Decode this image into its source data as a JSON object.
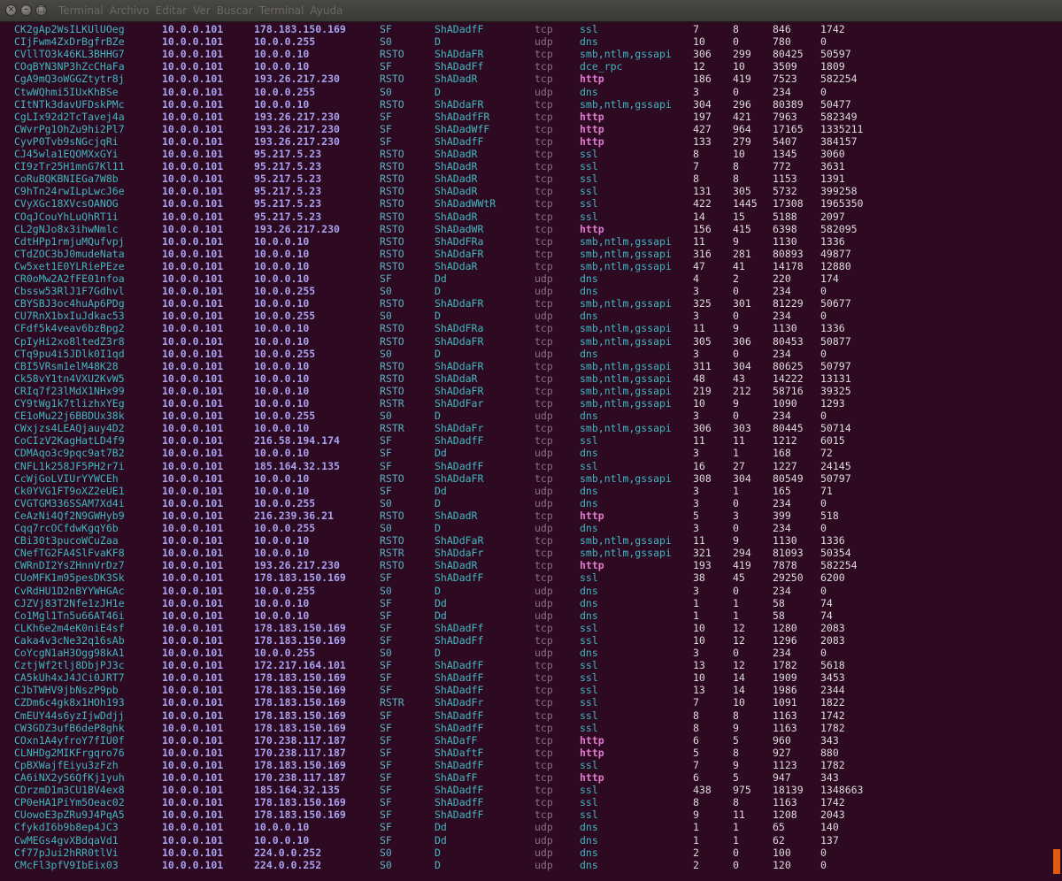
{
  "window": {
    "menu": [
      "Terminal",
      "Archivo",
      "Editar",
      "Ver",
      "Buscar",
      "Terminal",
      "Ayuda"
    ],
    "close_glyph": "×",
    "minimize_glyph": "–",
    "maximize_glyph": "□"
  },
  "colors": {
    "background": "#2d0922",
    "accent_http": "#e07bd0",
    "uid": "#3fb8c0",
    "ip": "#a8a2ef",
    "numeric": "#dddcdc",
    "resize_grip": "#e35a0f"
  },
  "rows": [
    [
      "CK2gAp2WsILKUlUOeg",
      "10.0.0.101",
      "178.183.150.169",
      "SF",
      "ShADadfF",
      "tcp",
      "ssl",
      "7",
      "8",
      "846",
      "1742"
    ],
    [
      "CIjFwm4ZxDrBgfrBZe",
      "10.0.0.101",
      "10.0.0.255",
      "S0",
      "D",
      "udp",
      "dns",
      "10",
      "0",
      "780",
      "0"
    ],
    [
      "CVllTO3k46KL3BHHG7",
      "10.0.0.101",
      "10.0.0.10",
      "RSTO",
      "ShADdaFR",
      "tcp",
      "smb,ntlm,gssapi",
      "306",
      "299",
      "80425",
      "50597"
    ],
    [
      "COqBYN3NP3hZcCHaFa",
      "10.0.0.101",
      "10.0.0.10",
      "SF",
      "ShADadFf",
      "tcp",
      "dce_rpc",
      "12",
      "10",
      "3509",
      "1809"
    ],
    [
      "CgA9mQ3oWGGZtytr8j",
      "10.0.0.101",
      "193.26.217.230",
      "RSTO",
      "ShADadR",
      "tcp",
      "http",
      "186",
      "419",
      "7523",
      "582254"
    ],
    [
      "CtwWQhmi5IUxKhBSe",
      "10.0.0.101",
      "10.0.0.255",
      "S0",
      "D",
      "udp",
      "dns",
      "3",
      "0",
      "234",
      "0"
    ],
    [
      "CItNTk3davUFDskPMc",
      "10.0.0.101",
      "10.0.0.10",
      "RSTO",
      "ShADdaFR",
      "tcp",
      "smb,ntlm,gssapi",
      "304",
      "296",
      "80389",
      "50477"
    ],
    [
      "CgLIx92d2TcTavej4a",
      "10.0.0.101",
      "193.26.217.230",
      "SF",
      "ShADadfFR",
      "tcp",
      "http",
      "197",
      "421",
      "7963",
      "582349"
    ],
    [
      "CWvrPg1OhZu9hi2Pl7",
      "10.0.0.101",
      "193.26.217.230",
      "SF",
      "ShADadWfF",
      "tcp",
      "http",
      "427",
      "964",
      "17165",
      "1335211"
    ],
    [
      "CyvP0Tvb9sNGcjqRi",
      "10.0.0.101",
      "193.26.217.230",
      "SF",
      "ShADadfF",
      "tcp",
      "http",
      "133",
      "279",
      "5407",
      "384157"
    ],
    [
      "CJ45wla1EQOMXxGYi",
      "10.0.0.101",
      "95.217.5.23",
      "RSTO",
      "ShADadR",
      "tcp",
      "ssl",
      "8",
      "10",
      "1345",
      "3060"
    ],
    [
      "CI9zTr25H1mnG7Kl11",
      "10.0.0.101",
      "95.217.5.23",
      "RSTO",
      "ShADadR",
      "tcp",
      "ssl",
      "7",
      "8",
      "772",
      "3631"
    ],
    [
      "CoRuBQKBNIEGa7W8b",
      "10.0.0.101",
      "95.217.5.23",
      "RSTO",
      "ShADadR",
      "tcp",
      "ssl",
      "8",
      "8",
      "1153",
      "1391"
    ],
    [
      "C9hTn24rwILpLwcJ6e",
      "10.0.0.101",
      "95.217.5.23",
      "RSTO",
      "ShADadR",
      "tcp",
      "ssl",
      "131",
      "305",
      "5732",
      "399258"
    ],
    [
      "CVyXGc18XVcsOANOG",
      "10.0.0.101",
      "95.217.5.23",
      "RSTO",
      "ShADadWWtR",
      "tcp",
      "ssl",
      "422",
      "1445",
      "17308",
      "1965350"
    ],
    [
      "COqJCouYhLuQhRT1i",
      "10.0.0.101",
      "95.217.5.23",
      "RSTO",
      "ShADadR",
      "tcp",
      "ssl",
      "14",
      "15",
      "5188",
      "2097"
    ],
    [
      "CL2gNJo8x3ihwNmlc",
      "10.0.0.101",
      "193.26.217.230",
      "RSTO",
      "ShADadWR",
      "tcp",
      "http",
      "156",
      "415",
      "6398",
      "582095"
    ],
    [
      "CdtHPp1rmjuMQufvpj",
      "10.0.0.101",
      "10.0.0.10",
      "RSTO",
      "ShADdFRa",
      "tcp",
      "smb,ntlm,gssapi",
      "11",
      "9",
      "1130",
      "1336"
    ],
    [
      "CTdZOC3bJ0mudeNata",
      "10.0.0.101",
      "10.0.0.10",
      "RSTO",
      "ShADdaFR",
      "tcp",
      "smb,ntlm,gssapi",
      "316",
      "281",
      "80893",
      "49877"
    ],
    [
      "Cw5xet1E0YLRiePEze",
      "10.0.0.101",
      "10.0.0.10",
      "RSTO",
      "ShADdaR",
      "tcp",
      "smb,ntlm,gssapi",
      "47",
      "41",
      "14178",
      "12880"
    ],
    [
      "CR0oMw2A2fFE01nfoa",
      "10.0.0.101",
      "10.0.0.10",
      "SF",
      "Dd",
      "udp",
      "dns",
      "4",
      "2",
      "220",
      "174"
    ],
    [
      "Cbssw53RlJ1F7Gdhvl",
      "10.0.0.101",
      "10.0.0.255",
      "S0",
      "D",
      "udp",
      "dns",
      "3",
      "0",
      "234",
      "0"
    ],
    [
      "CBYSBJ3oc4huAp6PDg",
      "10.0.0.101",
      "10.0.0.10",
      "RSTO",
      "ShADdaFR",
      "tcp",
      "smb,ntlm,gssapi",
      "325",
      "301",
      "81229",
      "50677"
    ],
    [
      "CU7RnX1bxIuJdkac53",
      "10.0.0.101",
      "10.0.0.255",
      "S0",
      "D",
      "udp",
      "dns",
      "3",
      "0",
      "234",
      "0"
    ],
    [
      "CFdf5k4veav6bzBpg2",
      "10.0.0.101",
      "10.0.0.10",
      "RSTO",
      "ShADdFRa",
      "tcp",
      "smb,ntlm,gssapi",
      "11",
      "9",
      "1130",
      "1336"
    ],
    [
      "CpIyHi2xo8ltedZ3r8",
      "10.0.0.101",
      "10.0.0.10",
      "RSTO",
      "ShADdaFR",
      "tcp",
      "smb,ntlm,gssapi",
      "305",
      "306",
      "80453",
      "50877"
    ],
    [
      "CTq9pu4i5JDlk0I1qd",
      "10.0.0.101",
      "10.0.0.255",
      "S0",
      "D",
      "udp",
      "dns",
      "3",
      "0",
      "234",
      "0"
    ],
    [
      "CBI5VRsm1elM48K28",
      "10.0.0.101",
      "10.0.0.10",
      "RSTO",
      "ShADdaFR",
      "tcp",
      "smb,ntlm,gssapi",
      "311",
      "304",
      "80625",
      "50797"
    ],
    [
      "Ck58vY1tn4VXU2KvW5",
      "10.0.0.101",
      "10.0.0.10",
      "RSTO",
      "ShADdaR",
      "tcp",
      "smb,ntlm,gssapi",
      "48",
      "43",
      "14222",
      "13131"
    ],
    [
      "CRIq7f23lMdX1NHx99",
      "10.0.0.101",
      "10.0.0.10",
      "RSTO",
      "ShADdaFR",
      "tcp",
      "smb,ntlm,gssapi",
      "219",
      "212",
      "58716",
      "39325"
    ],
    [
      "CY9tWg1k7tlizhxYEg",
      "10.0.0.101",
      "10.0.0.10",
      "RSTR",
      "ShADdFar",
      "tcp",
      "smb,ntlm,gssapi",
      "10",
      "9",
      "1090",
      "1293"
    ],
    [
      "CE1oMu22j6BBDUx38k",
      "10.0.0.101",
      "10.0.0.255",
      "S0",
      "D",
      "udp",
      "dns",
      "3",
      "0",
      "234",
      "0"
    ],
    [
      "CWxjzs4LEAQjauy4D2",
      "10.0.0.101",
      "10.0.0.10",
      "RSTR",
      "ShADdaFr",
      "tcp",
      "smb,ntlm,gssapi",
      "306",
      "303",
      "80445",
      "50714"
    ],
    [
      "CoCIzV2KagHatLD4f9",
      "10.0.0.101",
      "216.58.194.174",
      "SF",
      "ShADadfF",
      "tcp",
      "ssl",
      "11",
      "11",
      "1212",
      "6015"
    ],
    [
      "CDMAqo3c9pqc9at7B2",
      "10.0.0.101",
      "10.0.0.10",
      "SF",
      "Dd",
      "udp",
      "dns",
      "3",
      "1",
      "168",
      "72"
    ],
    [
      "CNFL1k258JF5PH2r7i",
      "10.0.0.101",
      "185.164.32.135",
      "SF",
      "ShADadfF",
      "tcp",
      "ssl",
      "16",
      "27",
      "1227",
      "24145"
    ],
    [
      "CcWjGoLVIUrYYWCEh",
      "10.0.0.101",
      "10.0.0.10",
      "RSTO",
      "ShADdaFR",
      "tcp",
      "smb,ntlm,gssapi",
      "308",
      "304",
      "80549",
      "50797"
    ],
    [
      "Ck0YVG1FT9oXZ2eUE1",
      "10.0.0.101",
      "10.0.0.10",
      "SF",
      "Dd",
      "udp",
      "dns",
      "3",
      "1",
      "165",
      "71"
    ],
    [
      "CVGTGM336SSAM7Xd4i",
      "10.0.0.101",
      "10.0.0.255",
      "S0",
      "D",
      "udp",
      "dns",
      "3",
      "0",
      "234",
      "0"
    ],
    [
      "CeAzNi4Qf2N9GWHyb9",
      "10.0.0.101",
      "216.239.36.21",
      "RSTO",
      "ShADadR",
      "tcp",
      "http",
      "5",
      "3",
      "399",
      "518"
    ],
    [
      "Cqq7rcOCfdwKgqY6b",
      "10.0.0.101",
      "10.0.0.255",
      "S0",
      "D",
      "udp",
      "dns",
      "3",
      "0",
      "234",
      "0"
    ],
    [
      "CBi30t3pucoWCuZaa",
      "10.0.0.101",
      "10.0.0.10",
      "RSTO",
      "ShADdFaR",
      "tcp",
      "smb,ntlm,gssapi",
      "11",
      "9",
      "1130",
      "1336"
    ],
    [
      "CNefTG2FA4SlFvaKF8",
      "10.0.0.101",
      "10.0.0.10",
      "RSTR",
      "ShADdaFr",
      "tcp",
      "smb,ntlm,gssapi",
      "321",
      "294",
      "81093",
      "50354"
    ],
    [
      "CWRnDI2YsZHnnVrDz7",
      "10.0.0.101",
      "193.26.217.230",
      "RSTO",
      "ShADadR",
      "tcp",
      "http",
      "193",
      "419",
      "7878",
      "582254"
    ],
    [
      "CUoMFK1m95pesDK3Sk",
      "10.0.0.101",
      "178.183.150.169",
      "SF",
      "ShADadfF",
      "tcp",
      "ssl",
      "38",
      "45",
      "29250",
      "6200"
    ],
    [
      "CvRdHU1D2nBYYWHGAc",
      "10.0.0.101",
      "10.0.0.255",
      "S0",
      "D",
      "udp",
      "dns",
      "3",
      "0",
      "234",
      "0"
    ],
    [
      "CJZVj83T2Nfe1zJH1e",
      "10.0.0.101",
      "10.0.0.10",
      "SF",
      "Dd",
      "udp",
      "dns",
      "1",
      "1",
      "58",
      "74"
    ],
    [
      "Co1Mgl1Tn5u66AT46i",
      "10.0.0.101",
      "10.0.0.10",
      "SF",
      "Dd",
      "udp",
      "dns",
      "1",
      "1",
      "58",
      "74"
    ],
    [
      "CLKh6e2m4eK0niE4sf",
      "10.0.0.101",
      "178.183.150.169",
      "SF",
      "ShADadFf",
      "tcp",
      "ssl",
      "10",
      "12",
      "1280",
      "2083"
    ],
    [
      "Caka4v3cNe32q16sAb",
      "10.0.0.101",
      "178.183.150.169",
      "SF",
      "ShADadFf",
      "tcp",
      "ssl",
      "10",
      "12",
      "1296",
      "2083"
    ],
    [
      "CoYcgN1aH3Ogg98kA1",
      "10.0.0.101",
      "10.0.0.255",
      "S0",
      "D",
      "udp",
      "dns",
      "3",
      "0",
      "234",
      "0"
    ],
    [
      "CztjWf2tlj8DbjPJ3c",
      "10.0.0.101",
      "172.217.164.101",
      "SF",
      "ShADadfF",
      "tcp",
      "ssl",
      "13",
      "12",
      "1782",
      "5618"
    ],
    [
      "CA5kUh4xJ4JCi0JRT7",
      "10.0.0.101",
      "178.183.150.169",
      "SF",
      "ShADadfF",
      "tcp",
      "ssl",
      "10",
      "14",
      "1909",
      "3453"
    ],
    [
      "CJbTWHV9jbNszP9pb",
      "10.0.0.101",
      "178.183.150.169",
      "SF",
      "ShADadfF",
      "tcp",
      "ssl",
      "13",
      "14",
      "1986",
      "2344"
    ],
    [
      "CZDm6c4gk8x1HOh193",
      "10.0.0.101",
      "178.183.150.169",
      "RSTR",
      "ShADadFr",
      "tcp",
      "ssl",
      "7",
      "10",
      "1091",
      "1822"
    ],
    [
      "CmEUY44s6yzIjwDdjj",
      "10.0.0.101",
      "178.183.150.169",
      "SF",
      "ShADadfF",
      "tcp",
      "ssl",
      "8",
      "8",
      "1163",
      "1742"
    ],
    [
      "CW3GDZ3ufB6deP8ghk",
      "10.0.0.101",
      "178.183.150.169",
      "SF",
      "ShADadfF",
      "tcp",
      "ssl",
      "8",
      "9",
      "1163",
      "1782"
    ],
    [
      "COxn1A4yfroY7fIU0f",
      "10.0.0.101",
      "170.238.117.187",
      "SF",
      "ShADafF",
      "tcp",
      "http",
      "6",
      "5",
      "960",
      "343"
    ],
    [
      "CLNHDg2MIKFrgqro76",
      "10.0.0.101",
      "170.238.117.187",
      "SF",
      "ShADaftF",
      "tcp",
      "http",
      "5",
      "8",
      "927",
      "880"
    ],
    [
      "CpBXWajfEiyu3zFzh",
      "10.0.0.101",
      "178.183.150.169",
      "SF",
      "ShADadfF",
      "tcp",
      "ssl",
      "7",
      "9",
      "1123",
      "1782"
    ],
    [
      "CA6iNX2yS6QfKj1yuh",
      "10.0.0.101",
      "170.238.117.187",
      "SF",
      "ShADafF",
      "tcp",
      "http",
      "6",
      "5",
      "947",
      "343"
    ],
    [
      "CDrzmD1m3CU1BV4ex8",
      "10.0.0.101",
      "185.164.32.135",
      "SF",
      "ShADadfF",
      "tcp",
      "ssl",
      "438",
      "975",
      "18139",
      "1348663"
    ],
    [
      "CP0eHA1PiYm5Oeac02",
      "10.0.0.101",
      "178.183.150.169",
      "SF",
      "ShADadfF",
      "tcp",
      "ssl",
      "8",
      "8",
      "1163",
      "1742"
    ],
    [
      "CUowoE3pZRu9J4PqA5",
      "10.0.0.101",
      "178.183.150.169",
      "SF",
      "ShADadfF",
      "tcp",
      "ssl",
      "9",
      "11",
      "1208",
      "2043"
    ],
    [
      "CfykdI6b9b8ep4JC3",
      "10.0.0.101",
      "10.0.0.10",
      "SF",
      "Dd",
      "udp",
      "dns",
      "1",
      "1",
      "65",
      "140"
    ],
    [
      "CwMEGs4gvXBdqaVd1",
      "10.0.0.101",
      "10.0.0.10",
      "SF",
      "Dd",
      "udp",
      "dns",
      "1",
      "1",
      "62",
      "137"
    ],
    [
      "Cf77pJui2hRR0tlVi",
      "10.0.0.101",
      "224.0.0.252",
      "S0",
      "D",
      "udp",
      "dns",
      "2",
      "0",
      "100",
      "0"
    ],
    [
      "CMcFl3pfV9IbEix03",
      "10.0.0.101",
      "224.0.0.252",
      "S0",
      "D",
      "udp",
      "dns",
      "2",
      "0",
      "120",
      "0"
    ]
  ]
}
